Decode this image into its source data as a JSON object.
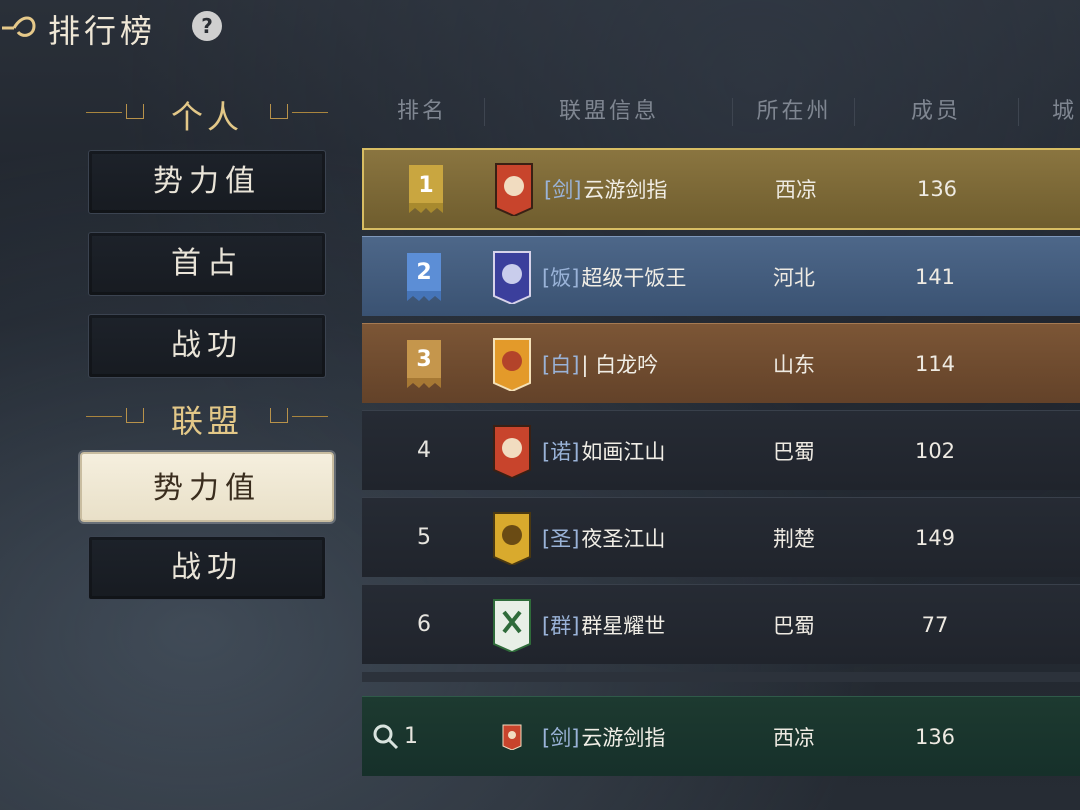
{
  "header": {
    "title": "排行榜",
    "help_label": "?"
  },
  "sidebar": {
    "personal": {
      "title": "个人",
      "items": [
        {
          "label": "势力值",
          "active": false
        },
        {
          "label": "首占",
          "active": false
        },
        {
          "label": "战功",
          "active": false
        }
      ]
    },
    "alliance": {
      "title": "联盟",
      "items": [
        {
          "label": "势力值",
          "active": true
        },
        {
          "label": "战功",
          "active": false
        }
      ]
    }
  },
  "table": {
    "columns": [
      "排名",
      "联盟信息",
      "所在州",
      "成员",
      "城"
    ],
    "rows": [
      {
        "rank": "1",
        "tag": "[剑]",
        "name": "云游剑指",
        "state": "西凉",
        "members": "136",
        "style": "gold",
        "emblem_color": "#c8442c"
      },
      {
        "rank": "2",
        "tag": "[饭]",
        "name": "超级干饭王",
        "state": "河北",
        "members": "141",
        "style": "blue",
        "emblem_color": "#3b3f9c"
      },
      {
        "rank": "3",
        "tag": "[白]",
        "name": "| 白龙吟",
        "state": "山东",
        "members": "114",
        "style": "bronze",
        "emblem_color": "#e39a2a"
      },
      {
        "rank": "4",
        "tag": "[诺]",
        "name": "如画江山",
        "state": "巴蜀",
        "members": "102",
        "style": "plain",
        "emblem_color": "#c8442c"
      },
      {
        "rank": "5",
        "tag": "[圣]",
        "name": "夜圣江山",
        "state": "荆楚",
        "members": "149",
        "style": "plain",
        "emblem_color": "#d9aa2d"
      },
      {
        "rank": "6",
        "tag": "[群]",
        "name": "群星耀世",
        "state": "巴蜀",
        "members": "77",
        "style": "plain",
        "emblem_color": "#e8efe6"
      }
    ],
    "my_row": {
      "rank": "1",
      "tag": "[剑]",
      "name": "云游剑指",
      "state": "西凉",
      "members": "136"
    }
  },
  "colors": {
    "gold_banner": "#c9a640",
    "blue_banner": "#5c8ed6",
    "bronze_banner": "#c5964c"
  }
}
